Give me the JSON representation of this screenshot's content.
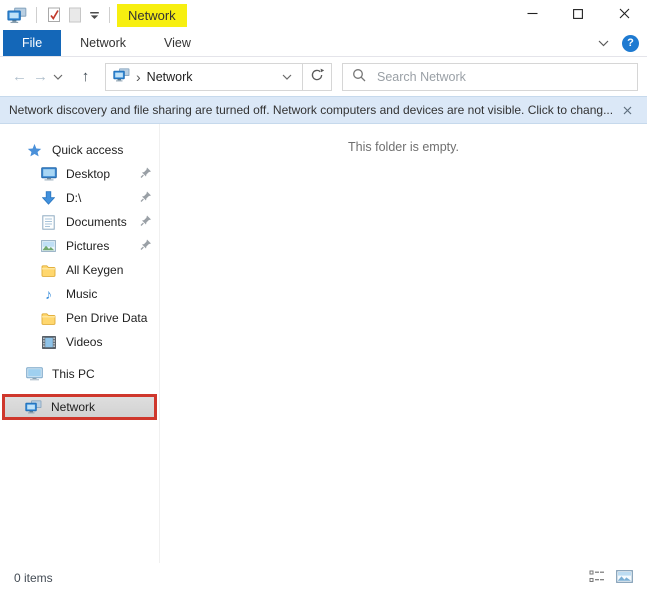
{
  "window": {
    "title": "Network"
  },
  "quick_access_toolbar": {
    "icons": [
      "network-computers-icon",
      "checkmark-doc-icon",
      "blank-doc-icon",
      "qat-customize-chevron-icon"
    ]
  },
  "ribbon": {
    "tabs": [
      {
        "label": "File",
        "active": true
      },
      {
        "label": "Network",
        "active": false
      },
      {
        "label": "View",
        "active": false
      }
    ],
    "help_label": "?"
  },
  "address_bar": {
    "breadcrumb": {
      "root_icon": "network-computers-icon",
      "separator": "›",
      "path": "Network"
    },
    "search_placeholder": "Search Network"
  },
  "notification_bar": {
    "text": "Network discovery and file sharing are turned off. Network computers and devices are not visible. Click to chang..."
  },
  "sidebar": {
    "items": [
      {
        "label": "Quick access",
        "icon": "star-icon",
        "level": 0,
        "pinned": false,
        "selected": false,
        "annotated": false,
        "gap_before": false
      },
      {
        "label": "Desktop",
        "icon": "monitor-icon",
        "level": 1,
        "pinned": true,
        "selected": false,
        "annotated": false,
        "gap_before": false
      },
      {
        "label": "D:\\",
        "icon": "down-arrow-icon",
        "level": 1,
        "pinned": true,
        "selected": false,
        "annotated": false,
        "gap_before": false
      },
      {
        "label": "Documents",
        "icon": "document-icon",
        "level": 1,
        "pinned": true,
        "selected": false,
        "annotated": false,
        "gap_before": false
      },
      {
        "label": "Pictures",
        "icon": "picture-icon",
        "level": 1,
        "pinned": true,
        "selected": false,
        "annotated": false,
        "gap_before": false
      },
      {
        "label": "All Keygen",
        "icon": "folder-icon",
        "level": 1,
        "pinned": false,
        "selected": false,
        "annotated": false,
        "gap_before": false
      },
      {
        "label": "Music",
        "icon": "music-note-icon",
        "level": 1,
        "pinned": false,
        "selected": false,
        "annotated": false,
        "gap_before": false
      },
      {
        "label": "Pen Drive Data",
        "icon": "folder-icon",
        "level": 1,
        "pinned": false,
        "selected": false,
        "annotated": false,
        "gap_before": false
      },
      {
        "label": "Videos",
        "icon": "film-icon",
        "level": 1,
        "pinned": false,
        "selected": false,
        "annotated": false,
        "gap_before": false
      },
      {
        "label": "This PC",
        "icon": "computer-icon",
        "level": 0,
        "pinned": false,
        "selected": false,
        "annotated": false,
        "gap_before": true
      },
      {
        "label": "Network",
        "icon": "network-computers-icon",
        "level": 0,
        "pinned": false,
        "selected": true,
        "annotated": true,
        "gap_before": true
      }
    ]
  },
  "main": {
    "empty_text": "This folder is empty."
  },
  "status_bar": {
    "items_count": "0 items",
    "view_icons": [
      "details-view-icon",
      "thumbnail-view-icon"
    ]
  },
  "colors": {
    "accent_blue": "#1467b8",
    "highlight_yellow": "#f7ef10",
    "annotation_red": "#cf372c",
    "notification_bg": "#dbe8f7",
    "selection_grey": "#d8d8d8",
    "icon_blue": "#3d8fdb",
    "folder_yellow": "#ffd76e"
  }
}
